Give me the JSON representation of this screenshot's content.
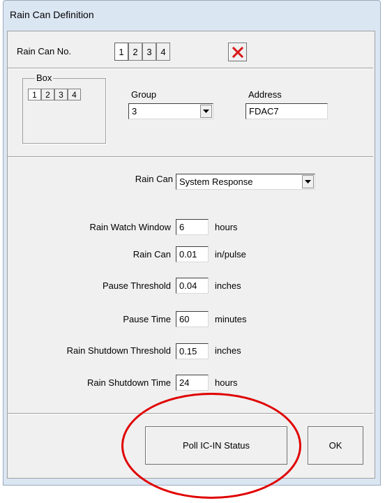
{
  "window": {
    "title": "Rain Can Definition"
  },
  "top": {
    "rain_can_no_label": "Rain Can No.",
    "tabs": [
      "1",
      "2",
      "3",
      "4"
    ],
    "active_tab": "1",
    "delete_icon": "red-x-icon"
  },
  "box": {
    "title": "Box",
    "tabs": [
      "1",
      "2",
      "3",
      "4"
    ],
    "active_tab": "1"
  },
  "group": {
    "label": "Group",
    "value": "3"
  },
  "address": {
    "label": "Address",
    "value": "FDAC7"
  },
  "rain_can_type": {
    "label": "Rain Can",
    "value": "System Response"
  },
  "fields": [
    {
      "label": "Rain Watch Window",
      "value": "6",
      "unit": "hours"
    },
    {
      "label": "Rain Can",
      "value": "0.01",
      "unit": "in/pulse"
    },
    {
      "label": "Pause Threshold",
      "value": "0.04",
      "unit": "inches"
    },
    {
      "label": "Pause Time",
      "value": "60",
      "unit": "minutes"
    },
    {
      "label": "Rain Shutdown Threshold",
      "value": "0.15",
      "unit": "inches"
    },
    {
      "label": "Rain Shutdown Time",
      "value": "24",
      "unit": "hours"
    }
  ],
  "buttons": {
    "poll": "Poll IC-IN Status",
    "ok": "OK"
  },
  "colors": {
    "highlight_ellipse": "#e00000",
    "delete_x": "#d81818"
  }
}
